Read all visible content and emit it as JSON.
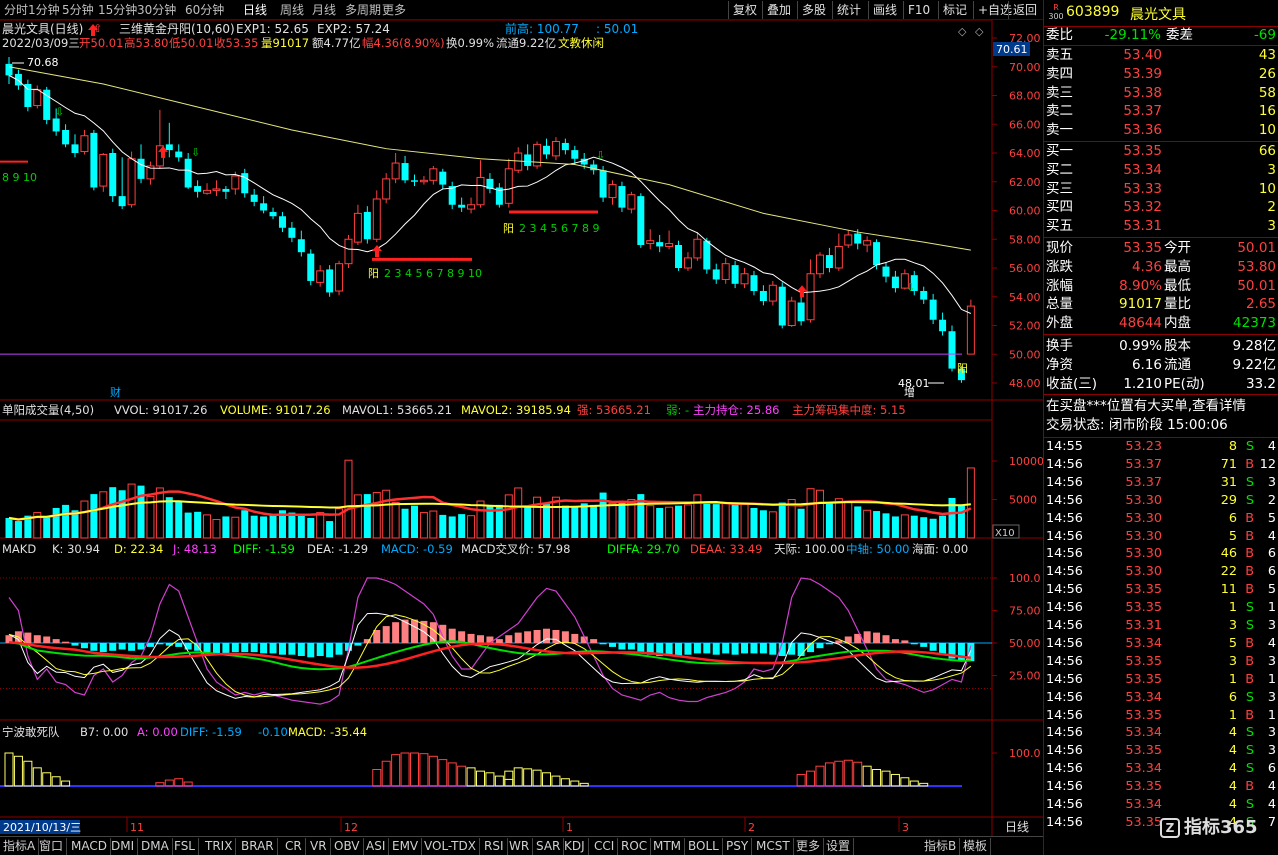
{
  "toolbar": {
    "tabs": [
      "分时",
      "1分钟",
      "5分钟",
      "15分钟",
      "30分钟",
      "60分钟",
      "日线",
      "周线",
      "月线",
      "多周期",
      "更多"
    ],
    "active": "日线",
    "right_buttons": [
      "复权",
      "叠加",
      "多股",
      "统计",
      "画线",
      "F10",
      "标记",
      "+自选",
      "返回"
    ]
  },
  "chart_header": {
    "title": "晨光文具(日线)",
    "indicator": "三维黄金丹阳(10,60)",
    "exp1": "EXP1: 52.65",
    "exp2": "EXP2: 57.24",
    "prev_high": "前高: 100.77",
    "prev_low": ": 50.01",
    "info_date": "2022/03/09三",
    "info_open": "开50.01",
    "info_high": "高53.80",
    "info_low": "低50.01",
    "info_close": "收53.35",
    "info_vol": "量91017",
    "info_amt": "额4.77亿",
    "info_change": "幅4.36(8.90%)",
    "info_turnover": "换0.99%",
    "info_float": "流通9.22亿",
    "info_sector": "文教休闲",
    "price_tag": "70.61",
    "hi_label": "70.68",
    "lo_label": "48.01",
    "yin_seq1": "8 9 10",
    "yang_seq1": "2 3 4 5 6 7 8 9 10",
    "yang_seq2": "2 3 4 5 6 7 8 9",
    "yang": "阳",
    "cai": "财",
    "zeng": "增"
  },
  "price_axis": [
    "72.00",
    "70.00",
    "68.00",
    "66.00",
    "64.00",
    "62.00",
    "60.00",
    "58.00",
    "56.00",
    "54.00",
    "52.00",
    "50.00",
    "48.00"
  ],
  "volume_header": {
    "name": "单阳成交量(4,50)",
    "vvol": "VVOL: 91017.26",
    "volume": "VOLUME: 91017.26",
    "mavol1": "MAVOL1: 53665.21",
    "mavol2": "MAVOL2: 39185.94",
    "strong": "强: 53665.21",
    "weak": "弱: -",
    "main_hold": "主力持仓: 25.86",
    "main_conc": "主力筹码集中度: 5.15"
  },
  "volume_axis": [
    "10000",
    "5000"
  ],
  "volume_unit": "X10",
  "makd_header": {
    "name": "MAKD",
    "k": "K: 30.94",
    "d": "D: 22.34",
    "j": "J: 48.13",
    "diff": "DIFF: -1.59",
    "dea": "DEA: -1.29",
    "macd": "MACD: -0.59",
    "cross": "MACD交叉价: 57.98",
    "diffa": "DIFFA: 29.70",
    "deaa": "DEAA: 33.49",
    "tianji": "天际: 100.00",
    "zhongzhou": "中轴: 50.00",
    "haimian": "海面: 0.00"
  },
  "makd_axis": [
    "100.0",
    "75.00",
    "50.00",
    "25.00"
  ],
  "nb_header": {
    "name": "宁波敢死队",
    "b7": "B7: 0.00",
    "a": "A: 0.00",
    "diff": "DIFF: -1.59",
    "dea": "-0.10",
    "macd": "MACD: -35.44"
  },
  "nb_axis": [
    "100.0"
  ],
  "date_axis": {
    "current": "2021/10/13/三",
    "labels": [
      "11",
      "12",
      "1",
      "2",
      "3"
    ],
    "period": "日线"
  },
  "bottom_tabs": [
    "指标A",
    "窗口",
    "MACD",
    "DMI",
    "DMA",
    "FSL",
    "TRIX",
    "BRAR",
    "CR",
    "VR",
    "OBV",
    "ASI",
    "EMV",
    "VOL-TDX",
    "RSI",
    "WR",
    "SAR",
    "KDJ",
    "CCI",
    "ROC",
    "MTM",
    "BOLL",
    "PSY",
    "MCST",
    "更多",
    "设置"
  ],
  "bottom_right": [
    "指标B",
    "模板"
  ],
  "stock": {
    "code": "603899",
    "name": "晨光文具",
    "badge": "R",
    "badge_sub": "300"
  },
  "order_book": {
    "weibi_label": "委比",
    "weibi": "-29.11%",
    "weicha_label": "委差",
    "weicha": "-69",
    "asks": [
      {
        "label": "卖五",
        "price": "53.40",
        "vol": "43"
      },
      {
        "label": "卖四",
        "price": "53.39",
        "vol": "26"
      },
      {
        "label": "卖三",
        "price": "53.38",
        "vol": "58"
      },
      {
        "label": "卖二",
        "price": "53.37",
        "vol": "16"
      },
      {
        "label": "卖一",
        "price": "53.36",
        "vol": "10"
      }
    ],
    "bids": [
      {
        "label": "买一",
        "price": "53.35",
        "vol": "66"
      },
      {
        "label": "买二",
        "price": "53.34",
        "vol": "3"
      },
      {
        "label": "买三",
        "price": "53.33",
        "vol": "10"
      },
      {
        "label": "买四",
        "price": "53.32",
        "vol": "2"
      },
      {
        "label": "买五",
        "price": "53.31",
        "vol": "3"
      }
    ]
  },
  "quote": [
    {
      "l1": "现价",
      "v1": "53.35",
      "l2": "今开",
      "v2": "50.01",
      "c1": "red",
      "c2": "red"
    },
    {
      "l1": "涨跌",
      "v1": "4.36",
      "l2": "最高",
      "v2": "53.80",
      "c1": "red",
      "c2": "red"
    },
    {
      "l1": "涨幅",
      "v1": "8.90%",
      "l2": "最低",
      "v2": "50.01",
      "c1": "red",
      "c2": "red"
    },
    {
      "l1": "总量",
      "v1": "91017",
      "l2": "量比",
      "v2": "2.65",
      "c1": "yellow",
      "c2": "red"
    },
    {
      "l1": "外盘",
      "v1": "48644",
      "l2": "内盘",
      "v2": "42373",
      "c1": "red",
      "c2": "green"
    },
    {
      "l1": "换手",
      "v1": "0.99%",
      "l2": "股本",
      "v2": "9.28亿",
      "c1": "white",
      "c2": "white"
    },
    {
      "l1": "净资",
      "v1": "6.16",
      "l2": "流通",
      "v2": "9.22亿",
      "c1": "white",
      "c2": "white"
    },
    {
      "l1": "收益(三)",
      "v1": "1.210",
      "l2": "PE(动)",
      "v2": "33.2",
      "c1": "white",
      "c2": "white"
    }
  ],
  "notice": "在买盘***位置有大买单,查看详情",
  "trade_status": "交易状态: 闭市阶段 15:00:06",
  "ticks": [
    {
      "t": "14:55",
      "p": "53.23",
      "v": "8",
      "s": "S",
      "n": "4",
      "pc": "red"
    },
    {
      "t": "14:56",
      "p": "53.37",
      "v": "71",
      "s": "B",
      "n": "12",
      "pc": "red"
    },
    {
      "t": "14:56",
      "p": "53.37",
      "v": "31",
      "s": "S",
      "n": "3",
      "pc": "red"
    },
    {
      "t": "14:56",
      "p": "53.30",
      "v": "29",
      "s": "S",
      "n": "2",
      "pc": "red"
    },
    {
      "t": "14:56",
      "p": "53.30",
      "v": "6",
      "s": "B",
      "n": "5",
      "pc": "red"
    },
    {
      "t": "14:56",
      "p": "53.30",
      "v": "5",
      "s": "B",
      "n": "4",
      "pc": "red"
    },
    {
      "t": "14:56",
      "p": "53.30",
      "v": "46",
      "s": "B",
      "n": "6",
      "pc": "red"
    },
    {
      "t": "14:56",
      "p": "53.30",
      "v": "22",
      "s": "B",
      "n": "6",
      "pc": "red"
    },
    {
      "t": "14:56",
      "p": "53.35",
      "v": "11",
      "s": "B",
      "n": "5",
      "pc": "red"
    },
    {
      "t": "14:56",
      "p": "53.35",
      "v": "1",
      "s": "S",
      "n": "1",
      "pc": "red"
    },
    {
      "t": "14:56",
      "p": "53.31",
      "v": "3",
      "s": "S",
      "n": "3",
      "pc": "red"
    },
    {
      "t": "14:56",
      "p": "53.34",
      "v": "5",
      "s": "B",
      "n": "4",
      "pc": "red"
    },
    {
      "t": "14:56",
      "p": "53.35",
      "v": "3",
      "s": "B",
      "n": "3",
      "pc": "red"
    },
    {
      "t": "14:56",
      "p": "53.35",
      "v": "1",
      "s": "B",
      "n": "1",
      "pc": "red"
    },
    {
      "t": "14:56",
      "p": "53.34",
      "v": "6",
      "s": "S",
      "n": "3",
      "pc": "red"
    },
    {
      "t": "14:56",
      "p": "53.35",
      "v": "1",
      "s": "B",
      "n": "1",
      "pc": "red"
    },
    {
      "t": "14:56",
      "p": "53.34",
      "v": "4",
      "s": "S",
      "n": "3",
      "pc": "red"
    },
    {
      "t": "14:56",
      "p": "53.35",
      "v": "4",
      "s": "S",
      "n": "3",
      "pc": "red"
    },
    {
      "t": "14:56",
      "p": "53.34",
      "v": "4",
      "s": "S",
      "n": "6",
      "pc": "red"
    },
    {
      "t": "14:56",
      "p": "53.35",
      "v": "4",
      "s": "B",
      "n": "4",
      "pc": "red"
    },
    {
      "t": "14:56",
      "p": "53.34",
      "v": "4",
      "s": "S",
      "n": "4",
      "pc": "red"
    },
    {
      "t": "14:56",
      "p": "53.35",
      "v": "4",
      "s": "S",
      "n": "7",
      "pc": "red"
    }
  ],
  "watermark": "指标365",
  "colors": {
    "up": "#ff4040",
    "down": "#00ffff",
    "ma_short": "#ffffff",
    "ma_long": "#e6e680",
    "border": "#8b0000"
  }
}
